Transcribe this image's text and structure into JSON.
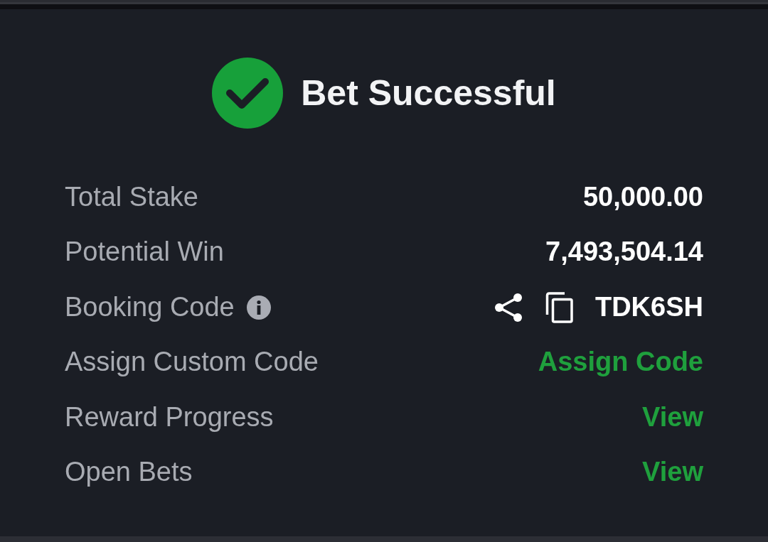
{
  "header": {
    "title": "Bet Successful"
  },
  "rows": [
    {
      "kind": "value",
      "label": "Total Stake",
      "value": "50,000.00"
    },
    {
      "kind": "value",
      "label": "Potential Win",
      "value": "7,493,504.14"
    },
    {
      "kind": "code",
      "label": "Booking Code",
      "value": "TDK6SH"
    },
    {
      "kind": "link",
      "label": "Assign Custom Code",
      "value": "Assign Code"
    },
    {
      "kind": "link",
      "label": "Reward Progress",
      "value": "View"
    },
    {
      "kind": "link",
      "label": "Open Bets",
      "value": "View"
    }
  ]
}
